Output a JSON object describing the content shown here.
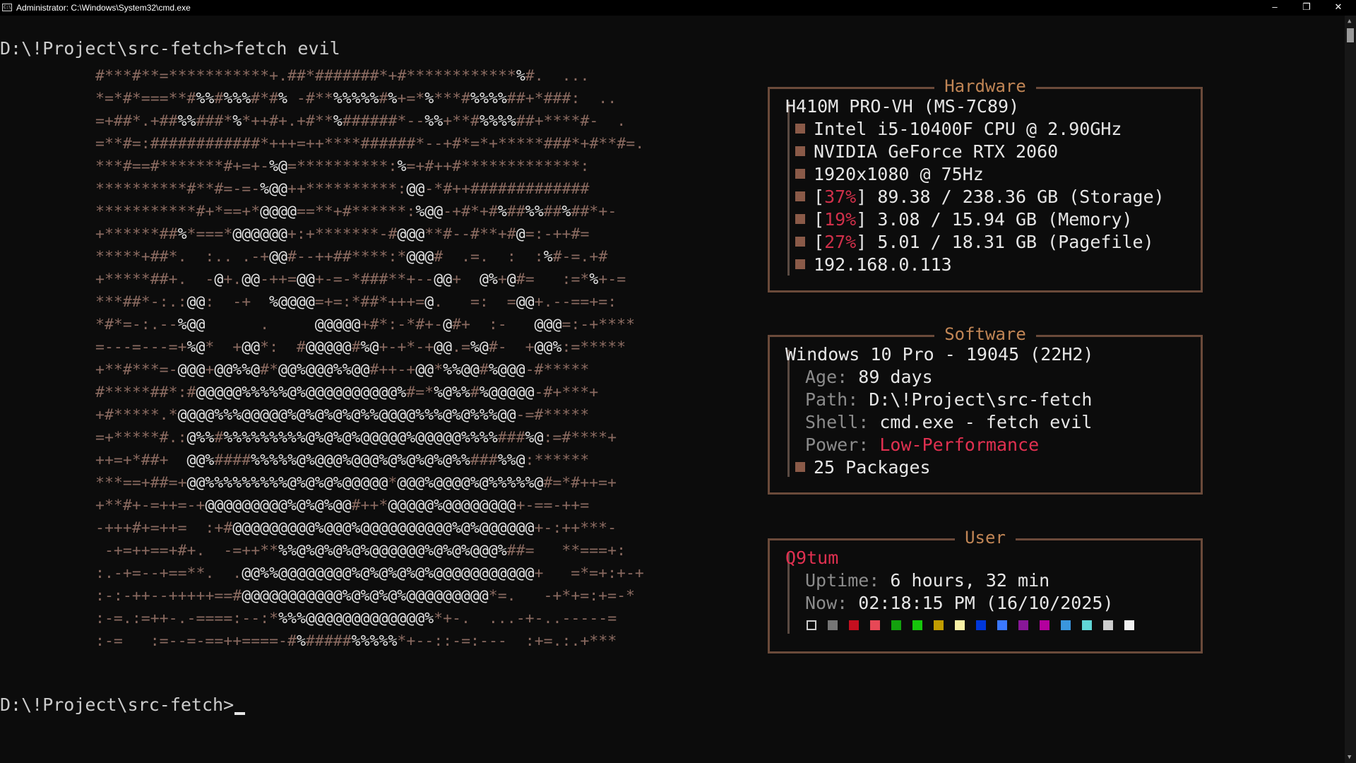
{
  "window": {
    "title": "Administrator: C:\\Windows\\System32\\cmd.exe",
    "icon_text": "C:\\",
    "minimize_glyph": "–",
    "maximize_glyph": "❐",
    "close_glyph": "✕"
  },
  "console": {
    "prompt1": "D:\\!Project\\src-fetch>fetch evil",
    "prompt2": "D:\\!Project\\src-fetch>"
  },
  "ascii_art": [
    "#***#**=***********+.##*#######*+#************%#.  ...",
    "*=*#*===**#%%#%%%#*#% -#**%%%%%#%+=*%***#%%%%##+*###:  ..",
    "=+##*.+##%%###*%*++#+.+#**%######*--%%+**#%%%%##+****#-  .",
    "=**#=:############*+++=++****######*--+#*=*+*****###*+#**#=.",
    "***#==#*******#+=+-%@=**********:%=+#++#*************:",
    "**********#**#=-=-%@@++**********:@@-*#++#############",
    "***********#+*==+*@@@@==**+#******:%@@-+#*+#%##%%##%##*+-",
    "+******##%*===*@@@@@@+:+*******-#@@@**#--#**+#@=:-++#=",
    "*****+##*.  :.. .-+@@#--++##****:*@@@#  .=.  :  :%#-=.+#",
    "+*****##+.  -@+.@@-++=@@+-=-*###**+--@@+  @%+@#=   :=*%+-=",
    "***##*-:.:@@:  -+  %@@@@=+=:*##*+++=@.   =:  =@@+.--==+=:",
    "*#*=-:.--%@@      .     @@@@@+#*:-*#+-@#+  :-   @@@=:-+****",
    "=---=---=+%@*  +@@*:  #@@@@@#%@+-+*-+@@.=%@#-  +@@%:=*****",
    "+**#***=-@@@+@@%%@#*@@%@@@%%@@#++-+@@*%%@@#%@@@-#*****",
    "#*****##*:#@@@@@%%%%%@%@@@@@@@@@@%#=*%@%%#%@@@@@-#+***+",
    "+#*****.*@@@@%%%@@@@@%@%@%@%@%%@@@@%%%@%@%%%@@-=#*****",
    "=+*****#.:@%%#%%%%%%%%%@%@%@%@@@@@%@@@@@%%%%###%@:=#****+",
    "++=+*##+  @@%####%%%%%@%@@@%@@@%@%@%@%@%%###%%@:******",
    "***==+##=+@@%%%%%%%%%@%@%@%@@@@@*@@@%@@@@%@%%%%%@#=*#++=+",
    "+**#+-=++=-+@@@@@@@@@%@%@%@@#++*@@@@@%@@@@@@@@+-==-++=",
    "-+++#+=++=  :+#@@@@@@@@@%@@@%@@@@@@@@@@%@%@@@@@@+-:++***-",
    " -+=++==+#+.  -=++**%%@%@%@%@%@@@@@@%@%@%@@@%##=   **===+:",
    ":.-+=--+==**.  .@@%%@@@@@@@@%@%@%@%@%@@@@@@@@@@@+   =*=+:+-+",
    ":-:-++--+++++==#@@@@@@@@@@@%@%@%@%@@@@@@@@@*=.   -+*+=:+=-*",
    ":-=.:=++-.-====:--:*%%%@@@@@@@@@@@@@%*+-.  ...-+-..-----=",
    ":-=   :=--=-==++====-#%#####%%%%%*+--::-=:---  :+=.:.+***"
  ],
  "hardware": {
    "title": "Hardware",
    "board": "H410M PRO-VH (MS-7C89)",
    "cpu": "Intel i5-10400F CPU @ 2.90GHz",
    "gpu": "NVIDIA GeForce RTX 2060",
    "display": "1920x1080 @ 75Hz",
    "storage": {
      "open": "[",
      "pct": "37%",
      "rest": "] 89.38 / 238.36 GB (Storage)"
    },
    "memory": {
      "open": "[",
      "pct": "19%",
      "rest": "] 3.08 / 15.94 GB (Memory)"
    },
    "pagefile": {
      "open": "[",
      "pct": "27%",
      "rest": "] 5.01 / 18.31 GB (Pagefile)"
    },
    "ip": "192.168.0.113"
  },
  "software": {
    "title": "Software",
    "os": "Windows 10 Pro - 19045 (22H2)",
    "age_key": "Age:",
    "age_val": "89 days",
    "path_key": "Path:",
    "path_val": "D:\\!Project\\src-fetch",
    "shell_key": "Shell:",
    "shell_val": "cmd.exe - fetch evil",
    "power_key": "Power:",
    "power_val": "Low-Performance",
    "packages": "25 Packages"
  },
  "user": {
    "title": "User",
    "name": "Q9tum",
    "uptime_key": "Uptime:",
    "uptime_val": "6 hours, 32 min",
    "now_key": "Now:",
    "now_val": "02:18:15 PM (16/10/2025)",
    "palette": [
      "#0c0c0c",
      "#767676",
      "#c50f1f",
      "#e74856",
      "#13a10e",
      "#16c60c",
      "#c19c00",
      "#f9f1a5",
      "#0037da",
      "#3b78ff",
      "#881798",
      "#b4009e",
      "#3a96dd",
      "#61d6d6",
      "#cccccc",
      "#f2f2f2"
    ]
  },
  "colors": {
    "background": "#0c0c0c",
    "panel_border": "#6b4a3a",
    "panel_title": "#c08555",
    "accent_red": "#e03050",
    "dim_key": "#8c8c8c"
  },
  "scrollbar": {
    "up_glyph": "▲",
    "down_glyph": "▼"
  }
}
